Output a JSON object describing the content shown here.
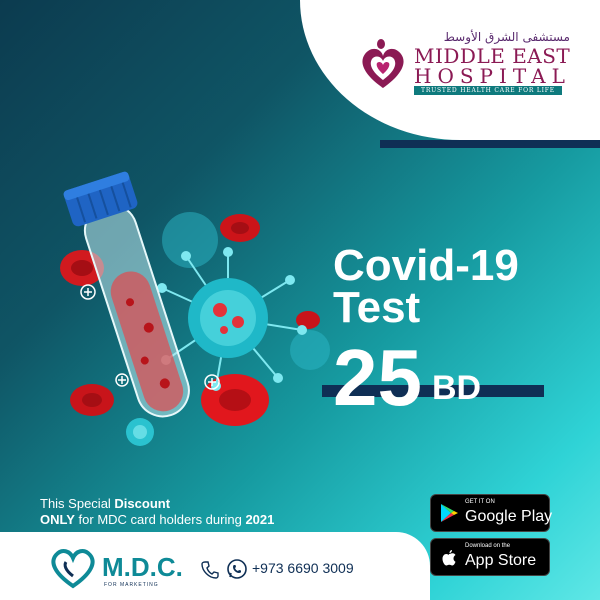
{
  "hospital": {
    "arabic_name": "مستشفى الشرق الأوسط",
    "name_line1": "MIDDLE EAST",
    "name_line2": "HOSPITAL",
    "tagline": "TRUSTED HEALTH CARE FOR LIFE"
  },
  "headline": {
    "line1": "Covid-19",
    "line2": "Test"
  },
  "price": {
    "amount": "25",
    "currency": "BD"
  },
  "offer": {
    "part1": "This Special ",
    "part2": "Discount",
    "part3": "ONLY",
    "part4": " for MDC card holders during ",
    "part5": "2021"
  },
  "footer": {
    "brand": "M.D.C.",
    "brand_sub": "FOR MARKETING",
    "phone": "+973 6690 3009"
  },
  "badges": {
    "google_small": "GET IT ON",
    "google_big": "Google Play",
    "apple_small": "Download on the",
    "apple_big": "App Store"
  },
  "colors": {
    "navy": "#0f2f55",
    "teal": "#0e8a97",
    "hospital_magenta": "#8b1a54"
  }
}
